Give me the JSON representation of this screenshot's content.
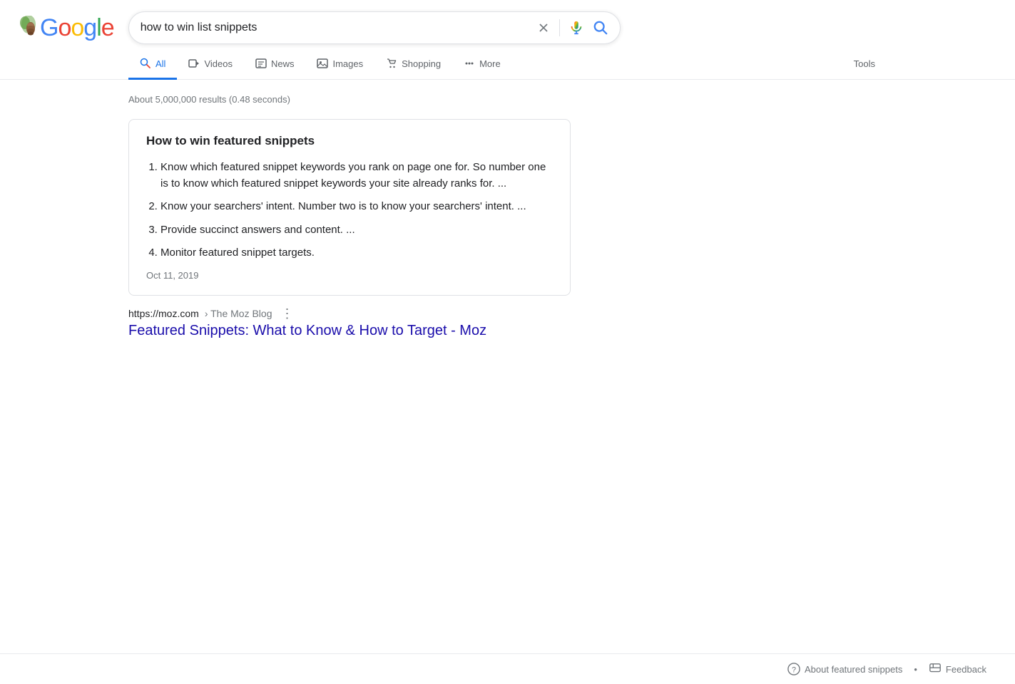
{
  "logo": {
    "letters": [
      "G",
      "o",
      "o",
      "g",
      "l",
      "e"
    ],
    "alt": "Google"
  },
  "search": {
    "query": "how to win list snippets",
    "clear_label": "×",
    "voice_label": "Search by voice",
    "search_label": "Google Search"
  },
  "nav": {
    "tabs": [
      {
        "id": "all",
        "label": "All",
        "active": true
      },
      {
        "id": "videos",
        "label": "Videos"
      },
      {
        "id": "news",
        "label": "News"
      },
      {
        "id": "images",
        "label": "Images"
      },
      {
        "id": "shopping",
        "label": "Shopping"
      },
      {
        "id": "more",
        "label": "More"
      }
    ],
    "tools_label": "Tools"
  },
  "results_count": "About 5,000,000 results (0.48 seconds)",
  "featured_snippet": {
    "title": "How to win featured snippets",
    "items": [
      "Know which featured snippet keywords you rank on page one for. So number one is to know which featured snippet keywords your site already ranks for. ...",
      "Know your searchers' intent. Number two is to know your searchers' intent. ...",
      "Provide succinct answers and content. ...",
      "Monitor featured snippet targets."
    ],
    "date": "Oct 11, 2019"
  },
  "result": {
    "url": "https://moz.com",
    "breadcrumb": "› The Moz Blog",
    "title": "Featured Snippets: What to Know & How to Target - Moz",
    "more_label": "⋮"
  },
  "footer": {
    "about_label": "About featured snippets",
    "dot": "•",
    "feedback_label": "Feedback"
  }
}
